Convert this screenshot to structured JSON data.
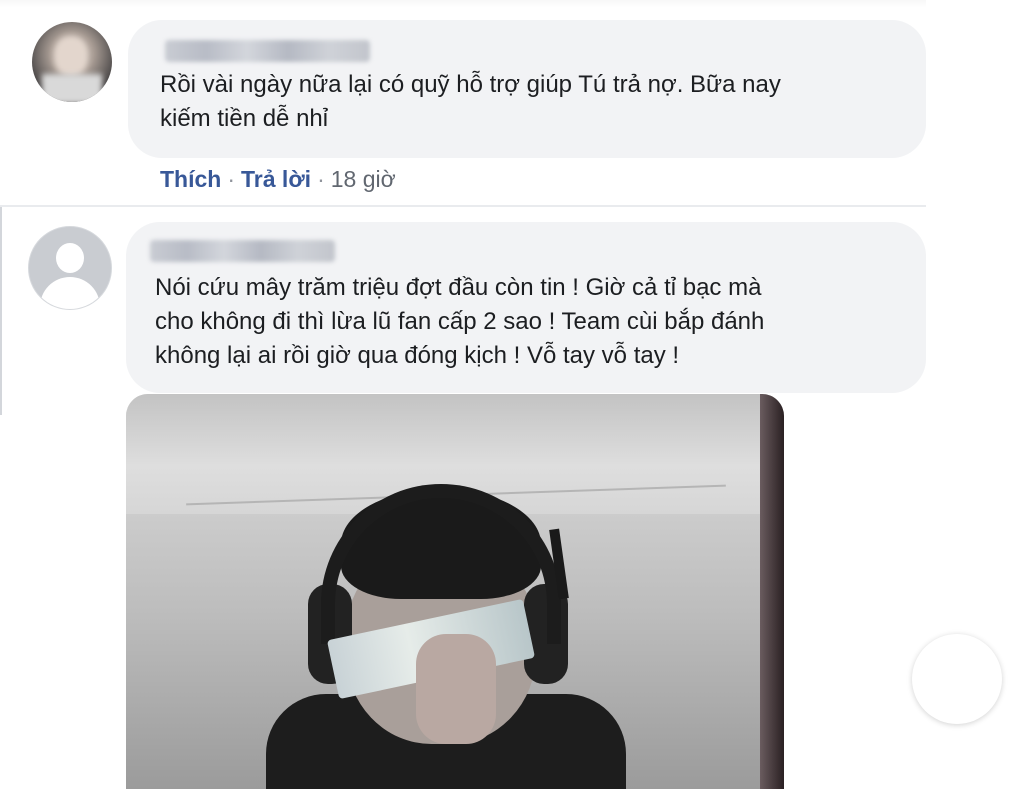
{
  "comments": [
    {
      "text": "Rồi vài ngày nữa lại có quỹ hỗ trợ giúp Tú trả nợ. Bữa nay\nkiếm tiền dễ nhỉ",
      "actions": {
        "like": "Thích",
        "reply": "Trả lời",
        "time": "18 giờ",
        "separator": "·"
      }
    },
    {
      "text": "Nói cứu mây trăm triệu đợt đầu còn tin ! Giờ cả tỉ bạc mà\ncho không đi thì lừa lũ fan cấp 2 sao ! Team cùi bắp đánh\nkhông lại ai rồi giờ qua đóng kịch ! Vỗ tay vỗ tay !"
    }
  ],
  "colors": {
    "bubble": "#f2f3f5",
    "link": "#385898",
    "text": "#1c1e21",
    "meta": "#616770"
  },
  "icons": {
    "avatar_2": "default-profile-icon"
  }
}
